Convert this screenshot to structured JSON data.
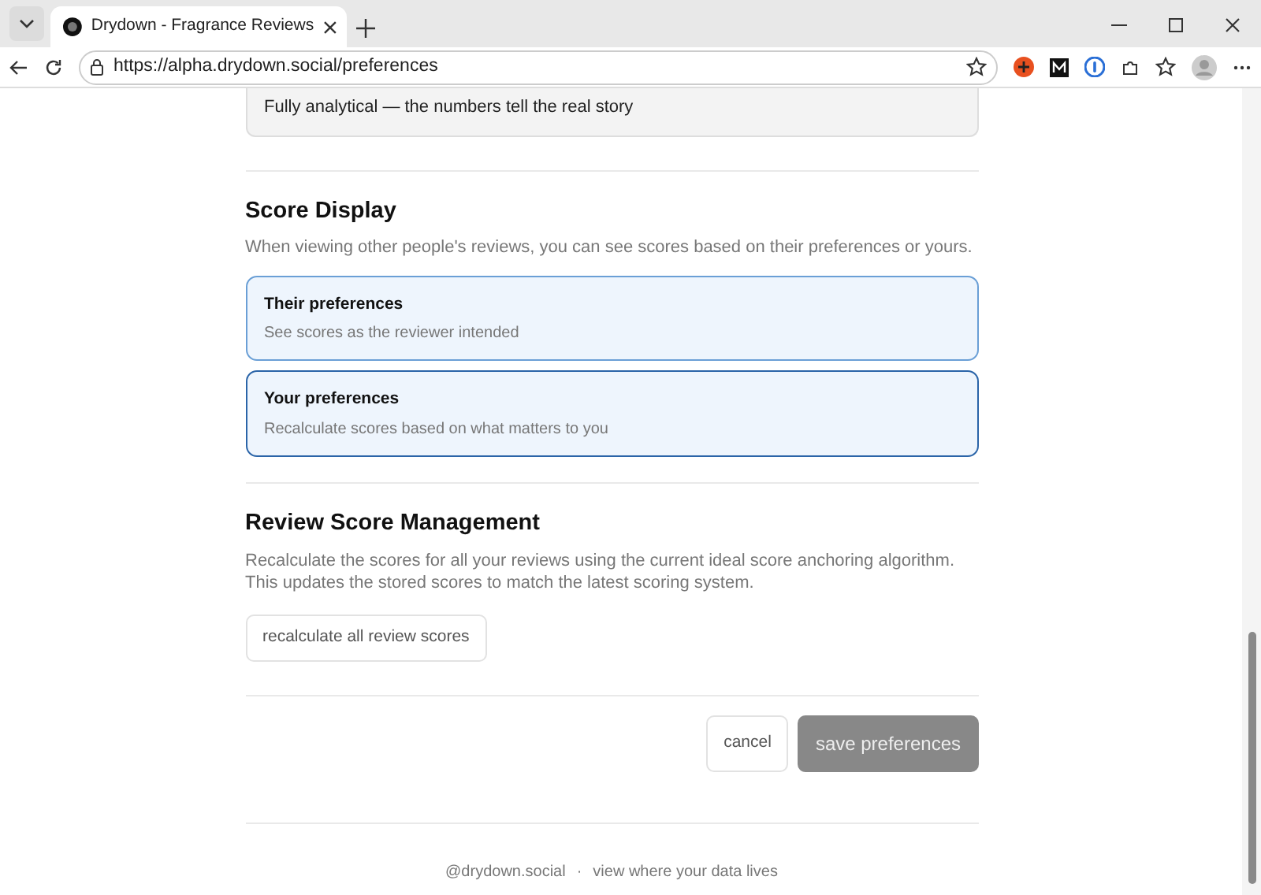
{
  "browser": {
    "tab_title": "Drydown - Fragrance Reviews",
    "url": "https://alpha.drydown.social/preferences"
  },
  "top_option": {
    "text": "Fully analytical — the numbers tell the real story"
  },
  "score_display": {
    "title": "Score Display",
    "description": "When viewing other people's reviews, you can see scores based on their preferences or yours.",
    "options": [
      {
        "title": "Their preferences",
        "subtitle": "See scores as the reviewer intended",
        "selected": false
      },
      {
        "title": "Your preferences",
        "subtitle": "Recalculate scores based on what matters to you",
        "selected": true
      }
    ]
  },
  "management": {
    "title": "Review Score Management",
    "description": "Recalculate the scores for all your reviews using the current ideal score anchoring algorithm. This updates the stored scores to match the latest scoring system.",
    "button": "recalculate all review scores"
  },
  "actions": {
    "cancel": "cancel",
    "save": "save preferences",
    "save_disabled": true
  },
  "footer": {
    "handle": "@drydown.social",
    "separator": "·",
    "link": "view where your data lives"
  }
}
